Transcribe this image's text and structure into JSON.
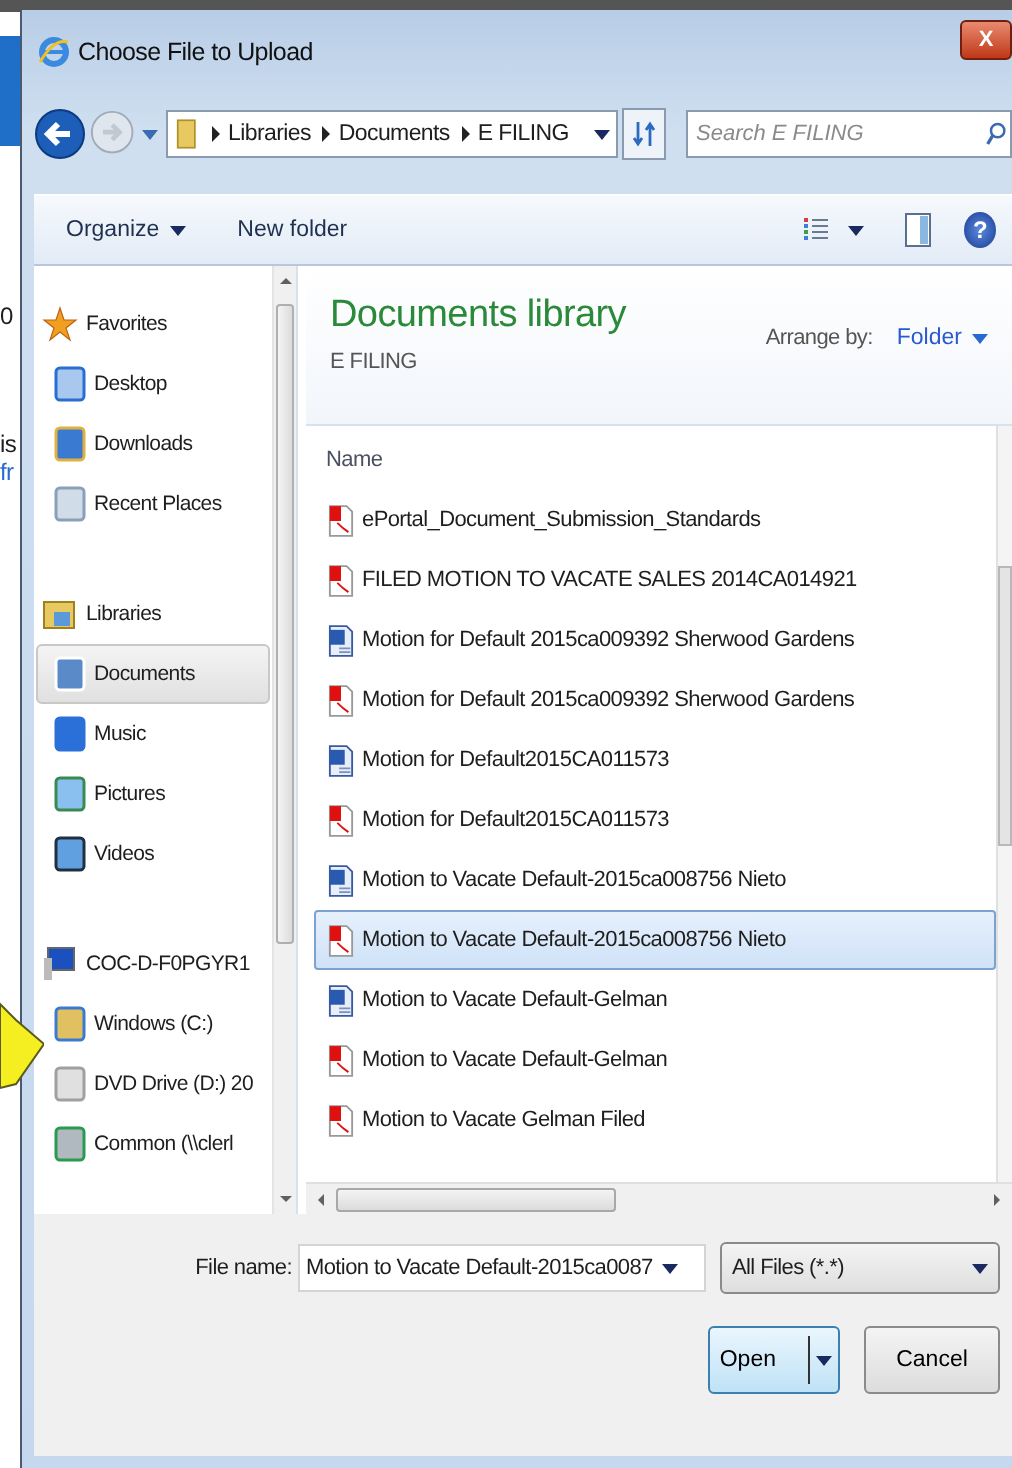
{
  "background_page": {
    "fragments": [
      "0",
      "is",
      "fr"
    ]
  },
  "window": {
    "title": "Choose File to Upload",
    "close": "X"
  },
  "address": {
    "breadcrumb": [
      "Libraries",
      "Documents",
      "E FILING"
    ]
  },
  "search": {
    "placeholder": "Search E FILING"
  },
  "toolbar": {
    "organize": "Organize",
    "new_folder": "New folder",
    "help": "?"
  },
  "sidebar": {
    "groups": [
      {
        "label": "Favorites",
        "items": [
          {
            "label": "Desktop",
            "selected": false
          },
          {
            "label": "Downloads",
            "selected": false
          },
          {
            "label": "Recent Places",
            "selected": false
          }
        ]
      },
      {
        "label": "Libraries",
        "items": [
          {
            "label": "Documents",
            "selected": true
          },
          {
            "label": "Music",
            "selected": false
          },
          {
            "label": "Pictures",
            "selected": false
          },
          {
            "label": "Videos",
            "selected": false
          }
        ]
      },
      {
        "label": "COC-D-F0PGYR1",
        "items": [
          {
            "label": "Windows (C:)",
            "selected": false
          },
          {
            "label": "DVD Drive (D:) 20",
            "selected": false
          },
          {
            "label": "Common (\\\\clerl",
            "selected": false
          }
        ]
      }
    ]
  },
  "library": {
    "title": "Documents library",
    "subtitle": "E FILING",
    "arrange_label": "Arrange by:",
    "arrange_value": "Folder"
  },
  "file_list": {
    "column": "Name",
    "files": [
      {
        "name": "ePortal_Document_Submission_Standards",
        "kind": "pdf",
        "selected": false
      },
      {
        "name": "FILED MOTION TO VACATE SALES  2014CA014921",
        "kind": "pdf",
        "selected": false
      },
      {
        "name": "Motion for Default 2015ca009392 Sherwood Gardens",
        "kind": "word",
        "selected": false
      },
      {
        "name": "Motion for Default 2015ca009392 Sherwood Gardens",
        "kind": "pdf",
        "selected": false
      },
      {
        "name": "Motion for Default2015CA011573",
        "kind": "word",
        "selected": false
      },
      {
        "name": "Motion for Default2015CA011573",
        "kind": "pdf",
        "selected": false
      },
      {
        "name": "Motion to Vacate Default-2015ca008756 Nieto",
        "kind": "word",
        "selected": false
      },
      {
        "name": "Motion to Vacate Default-2015ca008756 Nieto",
        "kind": "pdf",
        "selected": true
      },
      {
        "name": "Motion to Vacate Default-Gelman",
        "kind": "word",
        "selected": false
      },
      {
        "name": "Motion to Vacate Default-Gelman",
        "kind": "pdf",
        "selected": false
      },
      {
        "name": "Motion to Vacate Gelman Filed",
        "kind": "pdf",
        "selected": false
      }
    ]
  },
  "footer": {
    "file_name_label": "File name:",
    "file_name_value": "Motion to Vacate Default-2015ca0087",
    "filter": "All Files (*.*)",
    "open": "Open",
    "cancel": "Cancel"
  }
}
